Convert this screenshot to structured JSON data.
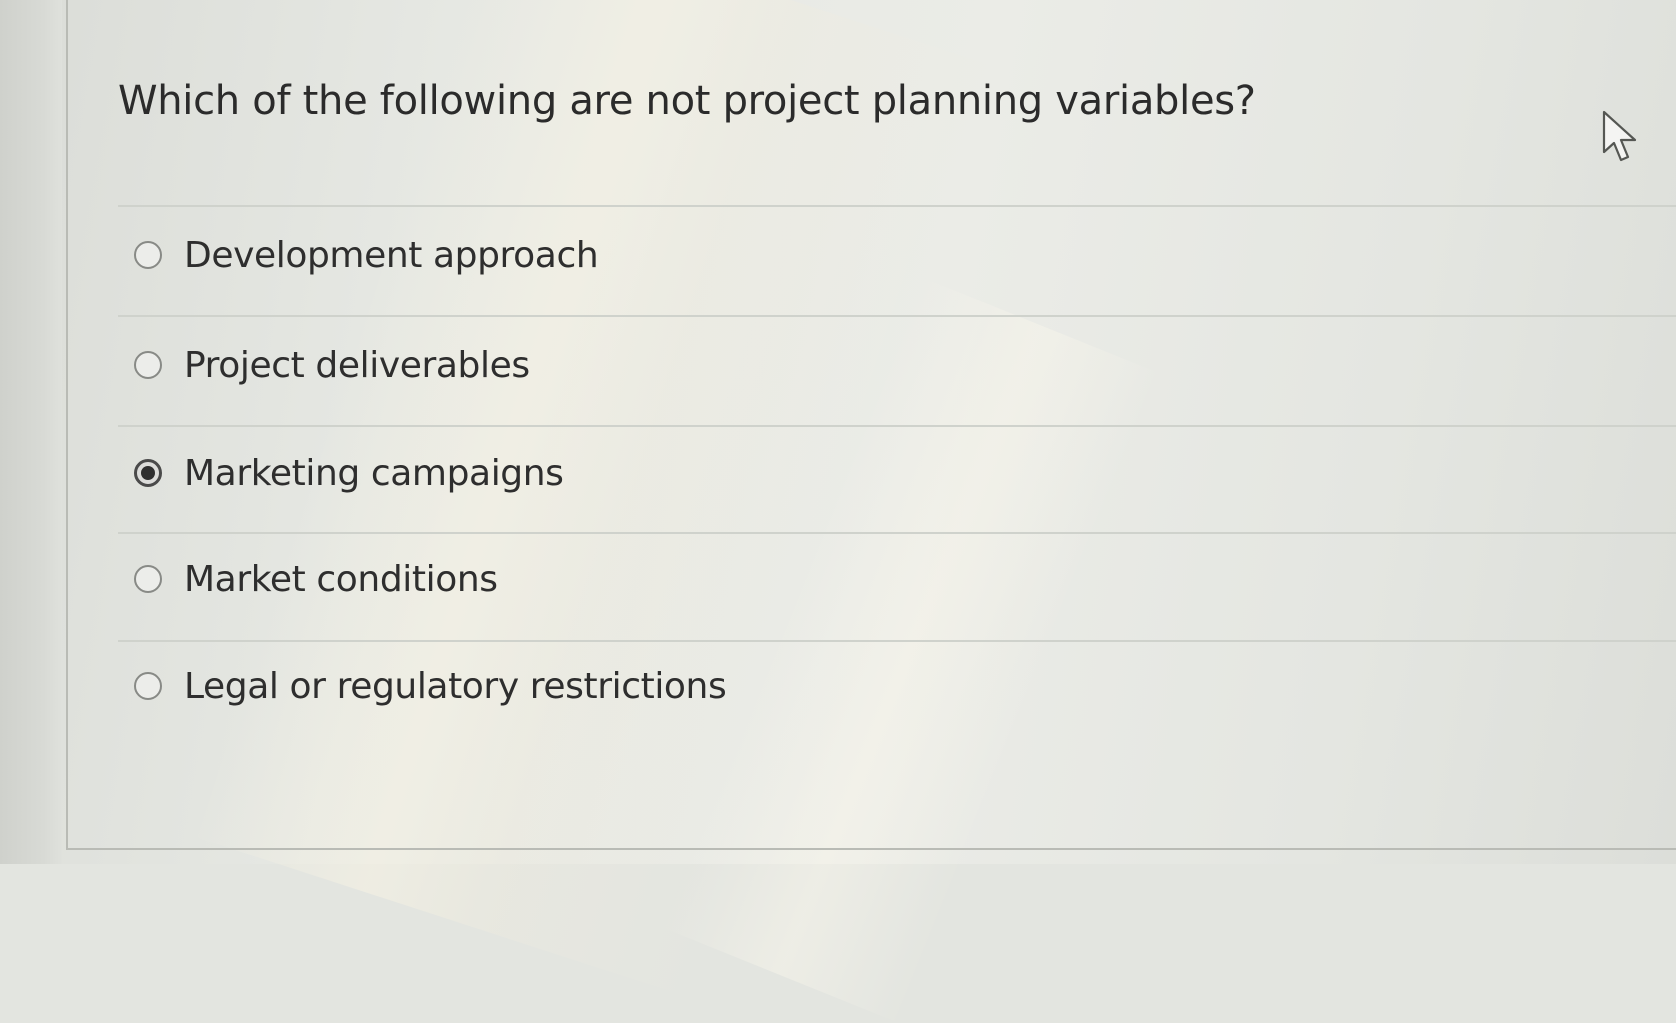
{
  "question": {
    "text": "Which of the following are not project planning variables?"
  },
  "options": [
    {
      "label": "Development approach",
      "checked": false
    },
    {
      "label": "Project deliverables",
      "checked": false
    },
    {
      "label": "Marketing campaigns",
      "checked": true
    },
    {
      "label": "Market conditions",
      "checked": false
    },
    {
      "label": "Legal or regulatory restrictions",
      "checked": false
    }
  ],
  "icons": {
    "cursor": "mouse-pointer-icon",
    "radio_unchecked": "radio-unchecked-icon",
    "radio_checked": "radio-checked-icon"
  },
  "colors": {
    "text": "#2e2e2e",
    "divider": "#cfd2cc",
    "radio_border": "#888a86",
    "radio_selected_dot": "#2f2f2f"
  }
}
